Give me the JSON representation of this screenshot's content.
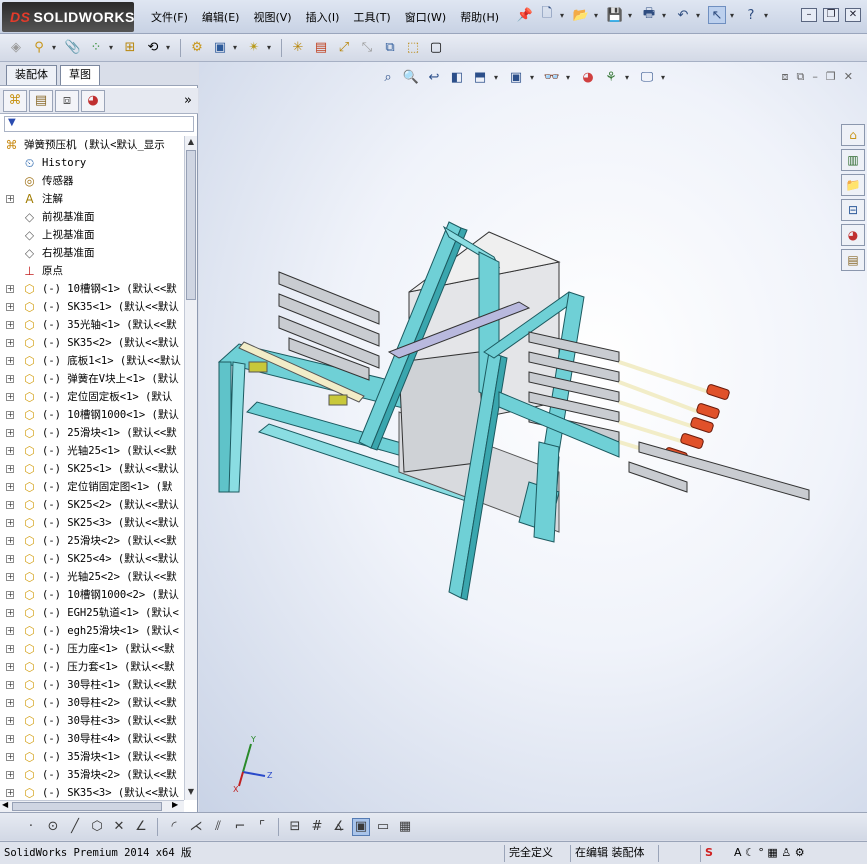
{
  "app": {
    "brand": "SOLIDWORKS",
    "brand_prefix": "DS"
  },
  "menu": [
    "文件(F)",
    "编辑(E)",
    "视图(V)",
    "插入(I)",
    "工具(T)",
    "窗口(W)",
    "帮助(H)"
  ],
  "left_panel": {
    "tabs": [
      "装配体",
      "草图"
    ],
    "active_tab": "草图",
    "tree": [
      {
        "icon": "assembly-icon",
        "label": "弹簧预压机  (默认<默认_显示",
        "expander": "",
        "indent": 0
      },
      {
        "icon": "history-icon",
        "label": "History",
        "expander": "",
        "indent": 1
      },
      {
        "icon": "sensor-icon",
        "label": "传感器",
        "expander": "",
        "indent": 1
      },
      {
        "icon": "annotation-icon",
        "label": "注解",
        "expander": "+",
        "indent": 1
      },
      {
        "icon": "plane-icon",
        "label": "前视基准面",
        "expander": "",
        "indent": 1
      },
      {
        "icon": "plane-icon",
        "label": "上视基准面",
        "expander": "",
        "indent": 1
      },
      {
        "icon": "plane-icon",
        "label": "右视基准面",
        "expander": "",
        "indent": 1
      },
      {
        "icon": "origin-icon",
        "label": "原点",
        "expander": "",
        "indent": 1
      },
      {
        "icon": "part-icon",
        "label": "(-) 10槽钢<1> (默认<<默",
        "expander": "+",
        "indent": 1
      },
      {
        "icon": "part-icon",
        "label": "(-) SK35<1> (默认<<默认",
        "expander": "+",
        "indent": 1
      },
      {
        "icon": "part-icon",
        "label": "(-) 35光轴<1> (默认<<默",
        "expander": "+",
        "indent": 1
      },
      {
        "icon": "part-icon",
        "label": "(-) SK35<2> (默认<<默认",
        "expander": "+",
        "indent": 1
      },
      {
        "icon": "part-icon",
        "label": "(-) 底板1<1> (默认<<默认",
        "expander": "+",
        "indent": 1
      },
      {
        "icon": "part-icon",
        "label": "(-) 弹簧在V块上<1> (默认",
        "expander": "+",
        "indent": 1
      },
      {
        "icon": "part-icon",
        "label": "(-) 定位固定板<1> (默认",
        "expander": "+",
        "indent": 1
      },
      {
        "icon": "part-icon",
        "label": "(-) 10槽钢1000<1> (默认",
        "expander": "+",
        "indent": 1
      },
      {
        "icon": "part-icon",
        "label": "(-) 25滑块<1> (默认<<默",
        "expander": "+",
        "indent": 1
      },
      {
        "icon": "part-icon",
        "label": "(-) 光轴25<1> (默认<<默",
        "expander": "+",
        "indent": 1
      },
      {
        "icon": "part-icon",
        "label": "(-) SK25<1> (默认<<默认",
        "expander": "+",
        "indent": 1
      },
      {
        "icon": "part-icon",
        "label": "(-) 定位销固定图<1> (默",
        "expander": "+",
        "indent": 1
      },
      {
        "icon": "part-icon",
        "label": "(-) SK25<2> (默认<<默认",
        "expander": "+",
        "indent": 1
      },
      {
        "icon": "part-icon",
        "label": "(-) SK25<3> (默认<<默认",
        "expander": "+",
        "indent": 1
      },
      {
        "icon": "part-icon",
        "label": "(-) 25滑块<2> (默认<<默",
        "expander": "+",
        "indent": 1
      },
      {
        "icon": "part-icon",
        "label": "(-) SK25<4> (默认<<默认",
        "expander": "+",
        "indent": 1
      },
      {
        "icon": "part-icon",
        "label": "(-) 光轴25<2> (默认<<默",
        "expander": "+",
        "indent": 1
      },
      {
        "icon": "part-icon",
        "label": "(-) 10槽钢1000<2> (默认",
        "expander": "+",
        "indent": 1
      },
      {
        "icon": "part-icon",
        "label": "(-) EGH25轨道<1> (默认<",
        "expander": "+",
        "indent": 1
      },
      {
        "icon": "part-icon",
        "label": "(-) egh25滑块<1> (默认<",
        "expander": "+",
        "indent": 1
      },
      {
        "icon": "part-icon",
        "label": "(-) 压力座<1> (默认<<默",
        "expander": "+",
        "indent": 1
      },
      {
        "icon": "part-icon",
        "label": "(-) 压力套<1> (默认<<默",
        "expander": "+",
        "indent": 1
      },
      {
        "icon": "part-icon",
        "label": "(-) 30导柱<1> (默认<<默",
        "expander": "+",
        "indent": 1
      },
      {
        "icon": "part-icon",
        "label": "(-) 30导柱<2> (默认<<默",
        "expander": "+",
        "indent": 1
      },
      {
        "icon": "part-icon",
        "label": "(-) 30导柱<3> (默认<<默",
        "expander": "+",
        "indent": 1
      },
      {
        "icon": "part-icon",
        "label": "(-) 30导柱<4> (默认<<默",
        "expander": "+",
        "indent": 1
      },
      {
        "icon": "part-icon",
        "label": "(-) 35滑块<1> (默认<<默",
        "expander": "+",
        "indent": 1
      },
      {
        "icon": "part-icon",
        "label": "(-) 35滑块<2> (默认<<默",
        "expander": "+",
        "indent": 1
      },
      {
        "icon": "part-icon",
        "label": "(-) SK35<3> (默认<<默认",
        "expander": "+",
        "indent": 1
      }
    ]
  },
  "viewport": {
    "triad_labels": {
      "x": "X",
      "y": "Y",
      "z": "Z"
    }
  },
  "statusbar": {
    "product": "SolidWorks Premium 2014 x64 版",
    "definition": "完全定义",
    "editing": "在编辑 装配体",
    "ime": "S"
  },
  "colors": {
    "frame": "#6fd0d6",
    "frame_dark": "#2f8a94",
    "steel": "#c9ccd1",
    "cylinder_tip": "#e0512a",
    "rail": "#f2edc8"
  }
}
